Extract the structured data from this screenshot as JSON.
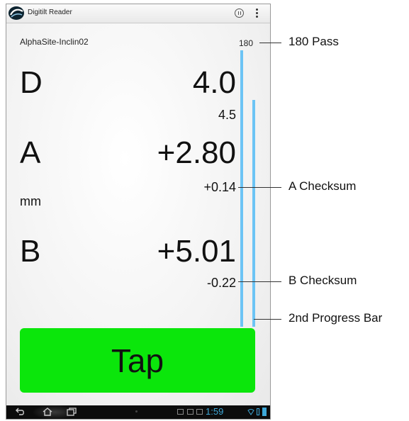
{
  "app": {
    "title": "Digitilt Reader"
  },
  "readout": {
    "site_name": "AlphaSite-Inclin02",
    "pass_count": "180",
    "depth_label": "D",
    "depth_value": "4.0",
    "next_depth": "4.5",
    "a_label": "A",
    "a_value": "+2.80",
    "a_checksum": "+0.14",
    "unit": "mm",
    "b_label": "B",
    "b_value": "+5.01",
    "b_checksum": "-0.22"
  },
  "tap_button": {
    "label": "Tap"
  },
  "system_bar": {
    "clock": "1:59"
  },
  "callouts": {
    "pass": "180 Pass",
    "a_checksum": "A Checksum",
    "b_checksum": "B Checksum",
    "progress_bar": "2nd Progress Bar"
  },
  "colors": {
    "tap_button": "#0be60b",
    "progress_bars": "#6cc4f5",
    "clock": "#3ea8d8"
  },
  "icons": [
    "app-logo-icon",
    "pause-icon",
    "overflow-menu-icon",
    "back-icon",
    "home-icon",
    "recent-apps-icon"
  ]
}
